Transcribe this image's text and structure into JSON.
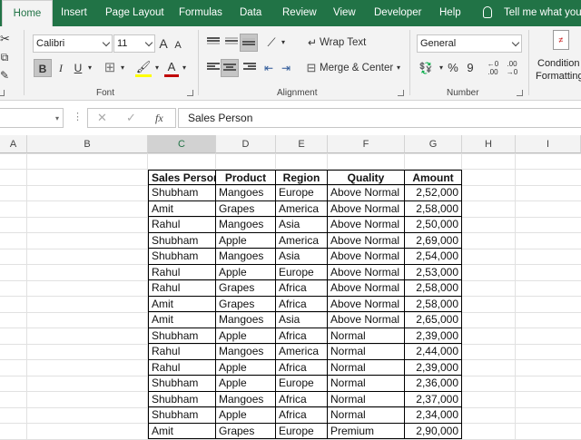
{
  "ribbon_tabs": [
    {
      "label": "Home",
      "active": true
    },
    {
      "label": "Insert"
    },
    {
      "label": "Page Layout"
    },
    {
      "label": "Formulas"
    },
    {
      "label": "Data"
    },
    {
      "label": "Review"
    },
    {
      "label": "View"
    },
    {
      "label": "Developer"
    },
    {
      "label": "Help"
    }
  ],
  "tell_me": "Tell me what you",
  "font": {
    "name": "Calibri",
    "size": "11",
    "grow_glyph": "A",
    "shrink_glyph": "A",
    "bold_glyph": "B",
    "italic_glyph": "I",
    "underline_glyph": "U",
    "color_glyph": "A",
    "group_label": "Font"
  },
  "alignment": {
    "wrap_text": "Wrap Text",
    "merge_center": "Merge & Center",
    "group_label": "Alignment"
  },
  "number": {
    "format": "General",
    "percent_glyph": "%",
    "comma_glyph": "9",
    "group_label": "Number"
  },
  "styles": {
    "conditional_line1": "Condition",
    "conditional_line2": "Formatting"
  },
  "formula_bar": {
    "fx": "fx",
    "content": "Sales Person"
  },
  "columns": [
    "A",
    "B",
    "C",
    "D",
    "E",
    "F",
    "G",
    "H",
    "I"
  ],
  "selected_column": "C",
  "colors": {
    "accent": "#217346",
    "ribbon_bg": "#f3f3f3",
    "header_selected": "#d2d2d2"
  },
  "table": {
    "headers": [
      "Sales Person",
      "Product",
      "Region",
      "Quality",
      "Amount"
    ],
    "rows": [
      [
        "Shubham",
        "Mangoes",
        "Europe",
        "Above Normal",
        "2,52,000"
      ],
      [
        "Amit",
        "Grapes",
        "America",
        "Above Normal",
        "2,58,000"
      ],
      [
        "Rahul",
        "Mangoes",
        "Asia",
        "Above Normal",
        "2,50,000"
      ],
      [
        "Shubham",
        "Apple",
        "America",
        "Above Normal",
        "2,69,000"
      ],
      [
        "Shubham",
        "Mangoes",
        "Asia",
        "Above Normal",
        "2,54,000"
      ],
      [
        "Rahul",
        "Apple",
        "Europe",
        "Above Normal",
        "2,53,000"
      ],
      [
        "Rahul",
        "Grapes",
        "Africa",
        "Above Normal",
        "2,58,000"
      ],
      [
        "Amit",
        "Grapes",
        "Africa",
        "Above Normal",
        "2,58,000"
      ],
      [
        "Amit",
        "Mangoes",
        "Asia",
        "Above Normal",
        "2,65,000"
      ],
      [
        "Shubham",
        "Apple",
        "Africa",
        "Normal",
        "2,39,000"
      ],
      [
        "Rahul",
        "Mangoes",
        "America",
        "Normal",
        "2,44,000"
      ],
      [
        "Rahul",
        "Apple",
        "Africa",
        "Normal",
        "2,39,000"
      ],
      [
        "Shubham",
        "Apple",
        "Europe",
        "Normal",
        "2,36,000"
      ],
      [
        "Shubham",
        "Mangoes",
        "Africa",
        "Normal",
        "2,37,000"
      ],
      [
        "Shubham",
        "Apple",
        "Africa",
        "Normal",
        "2,34,000"
      ],
      [
        "Amit",
        "Grapes",
        "Europe",
        "Premium",
        "2,90,000"
      ]
    ]
  }
}
